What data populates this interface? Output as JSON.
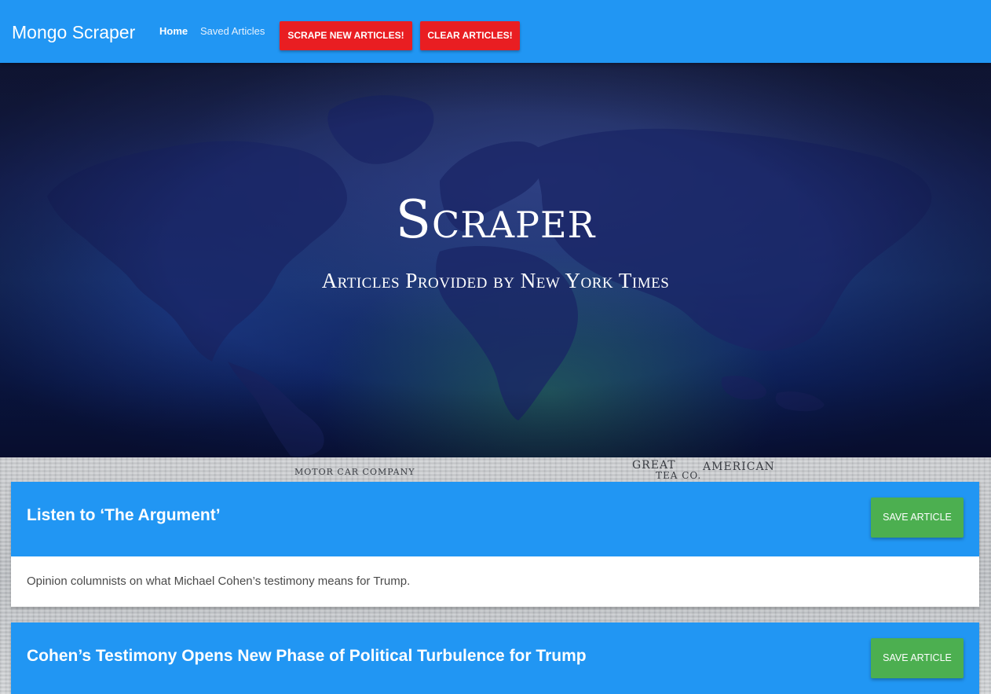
{
  "navbar": {
    "brand": "Mongo Scraper",
    "links": [
      {
        "label": "Home"
      },
      {
        "label": "Saved Articles"
      }
    ],
    "scrape_button": "SCRAPE NEW ARTICLES!",
    "clear_button": "CLEAR ARTICLES!",
    "color": "#2196f3",
    "button_color": "#e91e22"
  },
  "hero": {
    "title": "Scraper",
    "subtitle": "Articles Provided by New York Times"
  },
  "background_paper_text": [
    "MOTOR CAR COMPANY",
    "GREAT",
    "AMERICAN",
    "TEA CO."
  ],
  "articles": [
    {
      "title": "Listen to ‘The Argument’",
      "summary": "Opinion columnists on what Michael Cohen’s testimony means for Trump.",
      "save_label": "SAVE ARTICLE"
    },
    {
      "title": "Cohen’s Testimony Opens New Phase of Political Turbulence for Trump",
      "summary": "",
      "save_label": "SAVE ARTICLE"
    }
  ],
  "colors": {
    "card_header": "#2196f3",
    "save_button": "#4caf50"
  }
}
